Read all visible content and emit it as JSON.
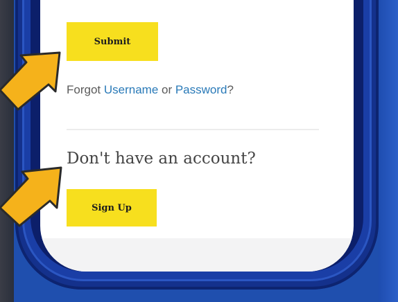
{
  "form": {
    "submit_label": "Submit",
    "forgot_prefix": "Forgot ",
    "username_link": "Username",
    "or_text": " or ",
    "password_link": "Password",
    "question_mark": "?",
    "no_account_heading": "Don't have an account?",
    "signup_label": "Sign Up"
  },
  "colors": {
    "button_yellow": "#f7df1e",
    "link_blue": "#2a7ab8",
    "background_blue": "#1f4fae",
    "arrow_orange": "#f5b21b"
  },
  "icons": [
    "arrow-pointer-icon",
    "arrow-pointer-icon"
  ]
}
